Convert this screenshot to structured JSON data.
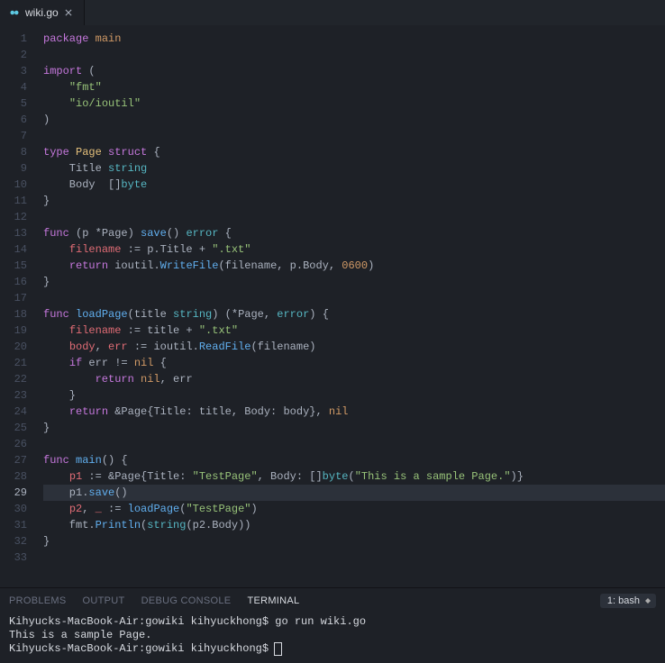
{
  "tab": {
    "filename": "wiki.go"
  },
  "active_line": 29,
  "panel": {
    "tabs": [
      "PROBLEMS",
      "OUTPUT",
      "DEBUG CONSOLE",
      "TERMINAL"
    ],
    "active": "TERMINAL",
    "shell_label": "1: bash"
  },
  "terminal_lines": [
    "Kihyucks-MacBook-Air:gowiki kihyuckhong$ go run wiki.go",
    "This is a sample Page.",
    "Kihyucks-MacBook-Air:gowiki kihyuckhong$ "
  ],
  "code": [
    [
      {
        "c": "kw",
        "t": "package"
      },
      {
        "c": "pl",
        "t": " "
      },
      {
        "c": "pkg",
        "t": "main"
      }
    ],
    [],
    [
      {
        "c": "kw",
        "t": "import"
      },
      {
        "c": "pl",
        "t": " ("
      }
    ],
    [
      {
        "c": "pl",
        "t": "    "
      },
      {
        "c": "str",
        "t": "\"fmt\""
      }
    ],
    [
      {
        "c": "pl",
        "t": "    "
      },
      {
        "c": "str",
        "t": "\"io/ioutil\""
      }
    ],
    [
      {
        "c": "pl",
        "t": ")"
      }
    ],
    [],
    [
      {
        "c": "kw",
        "t": "type"
      },
      {
        "c": "pl",
        "t": " "
      },
      {
        "c": "id",
        "t": "Page"
      },
      {
        "c": "pl",
        "t": " "
      },
      {
        "c": "kw",
        "t": "struct"
      },
      {
        "c": "pl",
        "t": " {"
      }
    ],
    [
      {
        "c": "pl",
        "t": "    Title "
      },
      {
        "c": "type",
        "t": "string"
      }
    ],
    [
      {
        "c": "pl",
        "t": "    Body  []"
      },
      {
        "c": "type",
        "t": "byte"
      }
    ],
    [
      {
        "c": "pl",
        "t": "}"
      }
    ],
    [],
    [
      {
        "c": "kw",
        "t": "func"
      },
      {
        "c": "pl",
        "t": " (p *Page) "
      },
      {
        "c": "fn",
        "t": "save"
      },
      {
        "c": "pl",
        "t": "() "
      },
      {
        "c": "err",
        "t": "error"
      },
      {
        "c": "pl",
        "t": " {"
      }
    ],
    [
      {
        "c": "pl",
        "t": "    "
      },
      {
        "c": "var",
        "t": "filename"
      },
      {
        "c": "pl",
        "t": " := p.Title + "
      },
      {
        "c": "str",
        "t": "\".txt\""
      }
    ],
    [
      {
        "c": "pl",
        "t": "    "
      },
      {
        "c": "kw",
        "t": "return"
      },
      {
        "c": "pl",
        "t": " ioutil."
      },
      {
        "c": "fn",
        "t": "WriteFile"
      },
      {
        "c": "pl",
        "t": "(filename, p.Body, "
      },
      {
        "c": "num",
        "t": "0600"
      },
      {
        "c": "pl",
        "t": ")"
      }
    ],
    [
      {
        "c": "pl",
        "t": "}"
      }
    ],
    [],
    [
      {
        "c": "kw",
        "t": "func"
      },
      {
        "c": "pl",
        "t": " "
      },
      {
        "c": "fn",
        "t": "loadPage"
      },
      {
        "c": "pl",
        "t": "(title "
      },
      {
        "c": "type",
        "t": "string"
      },
      {
        "c": "pl",
        "t": ") (*Page, "
      },
      {
        "c": "err",
        "t": "error"
      },
      {
        "c": "pl",
        "t": ") {"
      }
    ],
    [
      {
        "c": "pl",
        "t": "    "
      },
      {
        "c": "var",
        "t": "filename"
      },
      {
        "c": "pl",
        "t": " := title + "
      },
      {
        "c": "str",
        "t": "\".txt\""
      }
    ],
    [
      {
        "c": "pl",
        "t": "    "
      },
      {
        "c": "var",
        "t": "body"
      },
      {
        "c": "pl",
        "t": ", "
      },
      {
        "c": "var",
        "t": "err"
      },
      {
        "c": "pl",
        "t": " := ioutil."
      },
      {
        "c": "fn",
        "t": "ReadFile"
      },
      {
        "c": "pl",
        "t": "(filename)"
      }
    ],
    [
      {
        "c": "pl",
        "t": "    "
      },
      {
        "c": "kw",
        "t": "if"
      },
      {
        "c": "pl",
        "t": " err != "
      },
      {
        "c": "nil",
        "t": "nil"
      },
      {
        "c": "pl",
        "t": " {"
      }
    ],
    [
      {
        "c": "pl",
        "t": "        "
      },
      {
        "c": "kw",
        "t": "return"
      },
      {
        "c": "pl",
        "t": " "
      },
      {
        "c": "nil",
        "t": "nil"
      },
      {
        "c": "pl",
        "t": ", err"
      }
    ],
    [
      {
        "c": "pl",
        "t": "    }"
      }
    ],
    [
      {
        "c": "pl",
        "t": "    "
      },
      {
        "c": "kw",
        "t": "return"
      },
      {
        "c": "pl",
        "t": " &Page{Title: title, Body: body}, "
      },
      {
        "c": "nil",
        "t": "nil"
      }
    ],
    [
      {
        "c": "pl",
        "t": "}"
      }
    ],
    [],
    [
      {
        "c": "kw",
        "t": "func"
      },
      {
        "c": "pl",
        "t": " "
      },
      {
        "c": "fn",
        "t": "main"
      },
      {
        "c": "pl",
        "t": "() {"
      }
    ],
    [
      {
        "c": "pl",
        "t": "    "
      },
      {
        "c": "var",
        "t": "p1"
      },
      {
        "c": "pl",
        "t": " := &Page{Title: "
      },
      {
        "c": "str",
        "t": "\"TestPage\""
      },
      {
        "c": "pl",
        "t": ", Body: []"
      },
      {
        "c": "type",
        "t": "byte"
      },
      {
        "c": "pl",
        "t": "("
      },
      {
        "c": "str",
        "t": "\"This is a sample Page.\""
      },
      {
        "c": "pl",
        "t": ")}"
      }
    ],
    [
      {
        "c": "pl",
        "t": "    p1."
      },
      {
        "c": "fn",
        "t": "save"
      },
      {
        "c": "pl",
        "t": "()"
      }
    ],
    [
      {
        "c": "pl",
        "t": "    "
      },
      {
        "c": "var",
        "t": "p2"
      },
      {
        "c": "pl",
        "t": ", "
      },
      {
        "c": "var",
        "t": "_"
      },
      {
        "c": "pl",
        "t": " := "
      },
      {
        "c": "fn",
        "t": "loadPage"
      },
      {
        "c": "pl",
        "t": "("
      },
      {
        "c": "str",
        "t": "\"TestPage\""
      },
      {
        "c": "pl",
        "t": ")"
      }
    ],
    [
      {
        "c": "pl",
        "t": "    fmt."
      },
      {
        "c": "fn",
        "t": "Println"
      },
      {
        "c": "pl",
        "t": "("
      },
      {
        "c": "type",
        "t": "string"
      },
      {
        "c": "pl",
        "t": "(p2.Body))"
      }
    ],
    [
      {
        "c": "pl",
        "t": "}"
      }
    ],
    []
  ]
}
